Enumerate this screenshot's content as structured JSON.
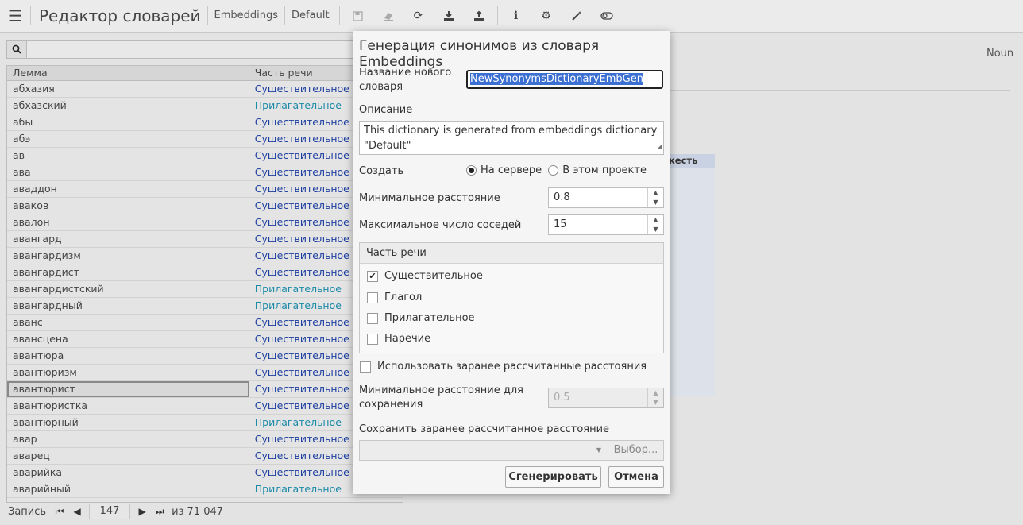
{
  "toolbar": {
    "app_title": "Редактор словарей",
    "crumbs": [
      "Embeddings",
      "Default"
    ],
    "icons": [
      "save-icon",
      "eraser-icon",
      "refresh-icon",
      "download-icon",
      "upload-icon",
      "info-icon",
      "settings-icon",
      "magic-wand-icon",
      "toggle-icon"
    ]
  },
  "grid": {
    "headers": {
      "lemma": "Лемма",
      "pos": "Часть речи"
    },
    "rows": [
      {
        "lemma": "абхазия",
        "pos": "Существительное",
        "kind": "noun"
      },
      {
        "lemma": "абхазский",
        "pos": "Прилагательное",
        "kind": "adj"
      },
      {
        "lemma": "абы",
        "pos": "Существительное",
        "kind": "noun"
      },
      {
        "lemma": "абэ",
        "pos": "Существительное",
        "kind": "noun"
      },
      {
        "lemma": "ав",
        "pos": "Существительное",
        "kind": "noun"
      },
      {
        "lemma": "ава",
        "pos": "Существительное",
        "kind": "noun"
      },
      {
        "lemma": "аваддон",
        "pos": "Существительное",
        "kind": "noun"
      },
      {
        "lemma": "аваков",
        "pos": "Существительное",
        "kind": "noun"
      },
      {
        "lemma": "авалон",
        "pos": "Существительное",
        "kind": "noun"
      },
      {
        "lemma": "авангард",
        "pos": "Существительное",
        "kind": "noun"
      },
      {
        "lemma": "авангардизм",
        "pos": "Существительное",
        "kind": "noun"
      },
      {
        "lemma": "авангардист",
        "pos": "Существительное",
        "kind": "noun"
      },
      {
        "lemma": "авангардистский",
        "pos": "Прилагательное",
        "kind": "adj"
      },
      {
        "lemma": "авангардный",
        "pos": "Прилагательное",
        "kind": "adj"
      },
      {
        "lemma": "аванс",
        "pos": "Существительное",
        "kind": "noun"
      },
      {
        "lemma": "авансцена",
        "pos": "Существительное",
        "kind": "noun"
      },
      {
        "lemma": "авантюра",
        "pos": "Существительное",
        "kind": "noun"
      },
      {
        "lemma": "авантюризм",
        "pos": "Существительное",
        "kind": "noun"
      },
      {
        "lemma": "авантюрист",
        "pos": "Существительное",
        "kind": "noun",
        "selected": true
      },
      {
        "lemma": "авантюристка",
        "pos": "Существительное",
        "kind": "noun"
      },
      {
        "lemma": "авантюрный",
        "pos": "Прилагательное",
        "kind": "adj"
      },
      {
        "lemma": "авар",
        "pos": "Существительное",
        "kind": "noun"
      },
      {
        "lemma": "аварец",
        "pos": "Существительное",
        "kind": "noun"
      },
      {
        "lemma": "аварийка",
        "pos": "Существительное",
        "kind": "noun"
      },
      {
        "lemma": "аварийный",
        "pos": "Прилагательное",
        "kind": "adj"
      }
    ]
  },
  "right": {
    "pos_value": "Noun",
    "panel_header": "кесть"
  },
  "pager": {
    "label": "Запись",
    "current": "147",
    "total": "из 71 047"
  },
  "dialog": {
    "title": "Генерация синонимов из словаря Embeddings",
    "name_label": "Название нового словаря",
    "name_value": "NewSynonymsDictionaryEmbGen",
    "desc_label": "Описание",
    "desc_value": "This dictionary is generated from embeddings dictionary \"Default\"",
    "create_label": "Создать",
    "create_options": [
      {
        "label": "На сервере",
        "checked": true
      },
      {
        "label": "В этом проекте",
        "checked": false
      }
    ],
    "min_dist_label": "Минимальное расстояние",
    "min_dist_value": "0.8",
    "max_neighbors_label": "Максимальное число соседей",
    "max_neighbors_value": "15",
    "pos_group_label": "Часть речи",
    "pos_options": [
      {
        "label": "Существительное",
        "checked": true
      },
      {
        "label": "Глагол",
        "checked": false
      },
      {
        "label": "Прилагательное",
        "checked": false
      },
      {
        "label": "Наречие",
        "checked": false
      }
    ],
    "use_precomputed_label": "Использовать заранее рассчитанные расстояния",
    "use_precomputed_checked": false,
    "min_save_label": "Минимальное расстояние для сохранения",
    "min_save_value": "0.5",
    "save_precomputed_label": "Сохранить заранее рассчитанное расстояние",
    "browse_label": "Выбор...",
    "generate_label": "Сгенерировать",
    "cancel_label": "Отмена"
  }
}
